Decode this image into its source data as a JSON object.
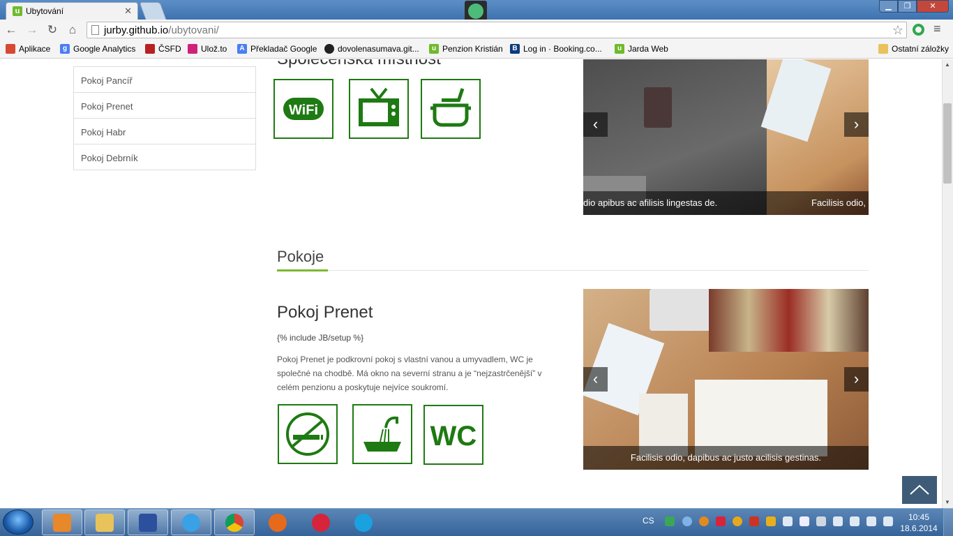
{
  "browser": {
    "tab_title": "Ubytování",
    "tab_close": "✕",
    "favicon_letter": "u",
    "url_host": "jurby.github.io",
    "url_path": "/ubytovani/",
    "window_controls": {
      "minimize": "▁",
      "maximize": "❐",
      "close": "✕"
    }
  },
  "bookmarks": {
    "items": [
      {
        "label": "Aplikace",
        "icon": "apps-grid-icon",
        "color": "#d64933"
      },
      {
        "label": "Google Analytics",
        "icon": "google-icon",
        "color": "#4a7ef5"
      },
      {
        "label": "ČSFD",
        "icon": "csfd-icon",
        "color": "#b92020"
      },
      {
        "label": "Ulož.to",
        "icon": "ulozto-icon",
        "color": "#d0217a"
      },
      {
        "label": "Překladač Google",
        "icon": "translate-icon",
        "color": "#4a7ef5"
      },
      {
        "label": "dovolenasumava.git...",
        "icon": "github-icon",
        "color": "#222222"
      },
      {
        "label": "Penzion Kristián",
        "icon": "u-icon",
        "color": "#6fba2c"
      },
      {
        "label": "Log in · Booking.co...",
        "icon": "booking-icon",
        "color": "#0c3b7c"
      },
      {
        "label": "Jarda Web",
        "icon": "u-icon",
        "color": "#6fba2c"
      }
    ],
    "other_label": "Ostatní záložky"
  },
  "page": {
    "sidebar_rooms": [
      "Pokoj Pancíř",
      "Pokoj Prenet",
      "Pokoj Habr",
      "Pokoj Debrník"
    ],
    "prev_section_title": "Společenská místnost",
    "prev_section_amenities": [
      "wifi-icon",
      "tv-icon",
      "cooking-pot-icon"
    ],
    "prev_wifi_text": "WiFi",
    "slider1_caption_left": "dio apibus ac afilisis lingestas de.",
    "slider1_caption_right": "Facilisis odio,",
    "pokoje_heading": "Pokoje",
    "room_title": "Pokoj Prenet",
    "room_setup": "{% include JB/setup %}",
    "room_description": "Pokoj Prenet je podkrovní pokoj s vlastní vanou a umyvadlem, WC je společné na chodbě. Má okno na severní stranu a je “nejzastrčenější” v celém penzionu a poskytuje nejvíce soukromí.",
    "room_amenities": [
      "no-smoking-icon",
      "bathtub-icon",
      "wc-icon"
    ],
    "wc_text": "WC",
    "slider2_caption": "Facilisis odio, dapibus ac justo acilisis gestinas.",
    "prev_arrow": "‹",
    "next_arrow": "›",
    "accent_color": "#7aba2c",
    "icon_green": "#1e7a12"
  },
  "taskbar": {
    "apps": [
      "outlook-icon",
      "explorer-icon",
      "save-icon",
      "internet-explorer-icon",
      "chrome-icon",
      "firefox-icon",
      "p-app-icon",
      "skype-icon"
    ],
    "lang": "CS",
    "time": "10:45",
    "date": "18.6.2014"
  }
}
